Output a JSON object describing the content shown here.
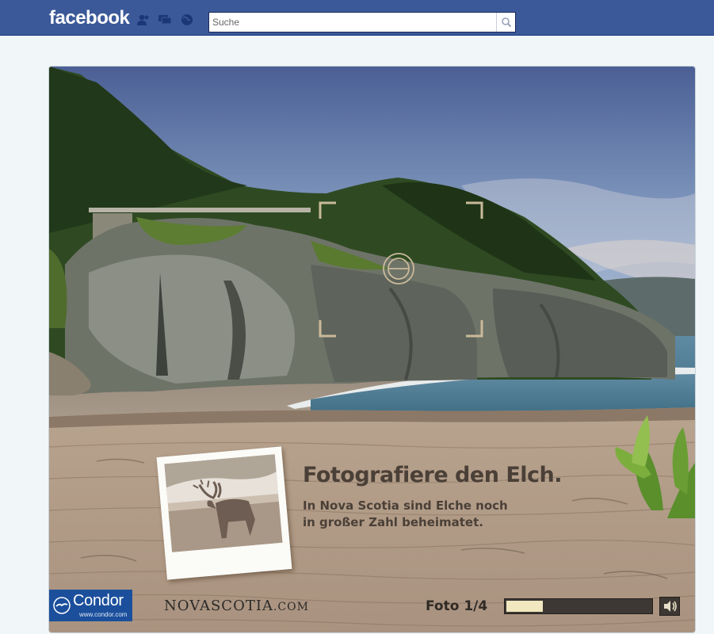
{
  "topbar": {
    "logo": "facebook",
    "search_placeholder": "Suche",
    "icons": [
      "friend-requests-icon",
      "messages-icon",
      "notifications-globe-icon",
      "magnifier-icon"
    ],
    "brand_color": "#3b5998"
  },
  "app": {
    "headline": "Fotografiere den Elch.",
    "subline": [
      "In Nova Scotia sind Elche noch",
      "in großer Zahl beheimatet."
    ],
    "polaroid_subject": "moose",
    "viewfinder_icon": "camera-viewfinder-icon",
    "footer": {
      "condor_brand": "Condor",
      "condor_url": "www.condor.com",
      "novascotia_logo": {
        "nova": "NOVA",
        "scotia": "SCOTIA",
        "domain": ".COM"
      },
      "photo_counter": "Foto 1/4",
      "progress": 0.25,
      "speaker_icon": "speaker-icon"
    }
  }
}
